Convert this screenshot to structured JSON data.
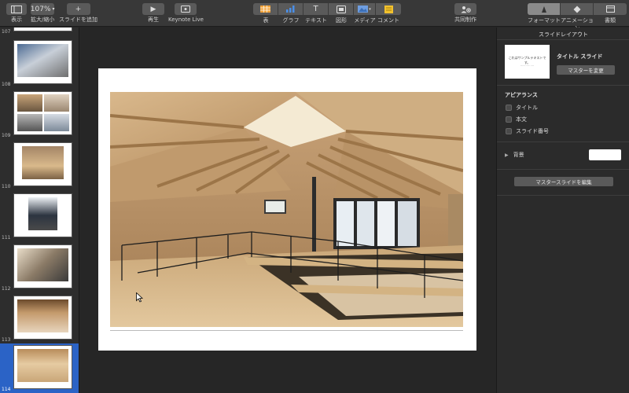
{
  "toolbar": {
    "view_label": "表示",
    "zoom_value": "107%",
    "zoom_label": "拡大/縮小",
    "add_slide_label": "スライドを追加",
    "play_label": "再生",
    "keynote_live_label": "Keynote Live",
    "table_label": "表",
    "chart_label": "グラフ",
    "text_label": "テキスト",
    "shape_label": "図形",
    "media_label": "メディア",
    "comment_label": "コメント",
    "collaborate_label": "共同制作",
    "tabs": [
      {
        "label": "フォーマット",
        "active": true
      },
      {
        "label": "アニメーション",
        "active": false
      },
      {
        "label": "書類",
        "active": false
      }
    ]
  },
  "navigator": {
    "slides": [
      {
        "number": "107",
        "selected": false
      },
      {
        "number": "108",
        "selected": false
      },
      {
        "number": "109",
        "selected": false
      },
      {
        "number": "110",
        "selected": false
      },
      {
        "number": "111",
        "selected": false
      },
      {
        "number": "112",
        "selected": false
      },
      {
        "number": "113",
        "selected": false
      },
      {
        "number": "114",
        "selected": true
      }
    ]
  },
  "inspector": {
    "title": "スライドレイアウト",
    "layout_preview_title": "これはサンプルテキストです。",
    "layout_preview_sub": "------ ---- ----",
    "layout_name": "タイトル スライド",
    "change_master_label": "マスターを変更",
    "appearance_title": "アピアランス",
    "checkboxes": [
      {
        "label": "タイトル",
        "checked": false
      },
      {
        "label": "本文",
        "checked": false
      },
      {
        "label": "スライド番号",
        "checked": false
      }
    ],
    "background_label": "背景",
    "background_color": "#ffffff",
    "edit_master_label": "マスタースライドを編集"
  },
  "colors": {
    "accent": "#2b63c6",
    "toolbar": "#383838",
    "panel": "#2b2b2b"
  }
}
